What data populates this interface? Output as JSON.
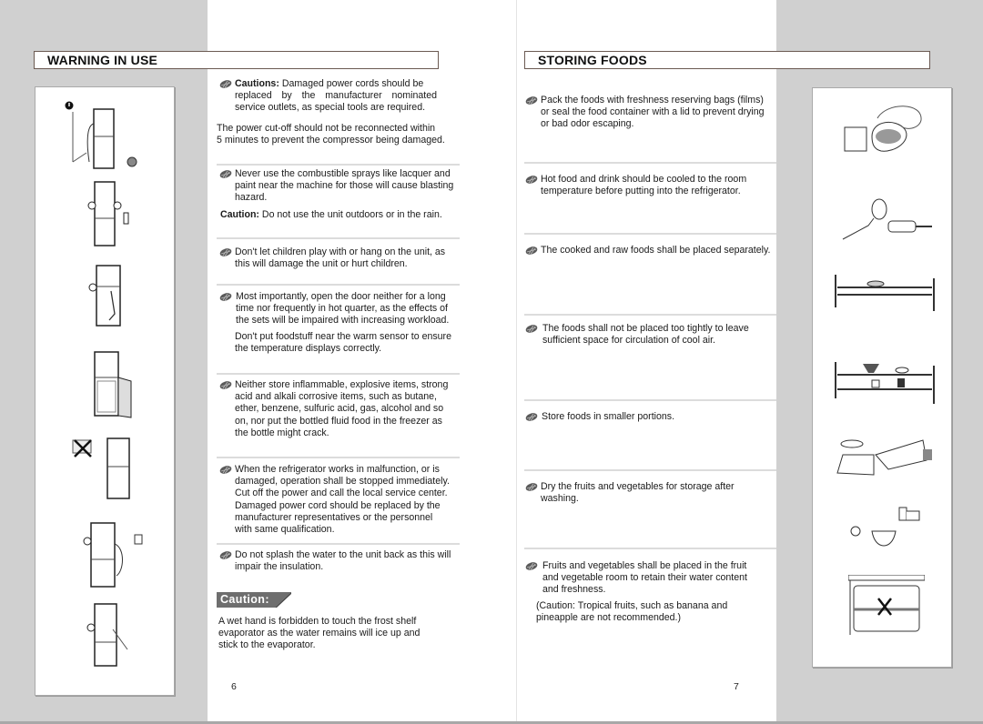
{
  "left_page": {
    "title": "WARNING IN USE",
    "page_number": "6",
    "items": [
      {
        "label": "Cautions:",
        "text_lines": [
          "Damaged power cords should be",
          "replaced  by  the  manufacturer  nominated",
          "service outlets, as special tools are required."
        ],
        "note_lines": [
          "The power cut-off should not be reconnected within",
          "5 minutes to prevent the compressor being damaged."
        ]
      },
      {
        "text_lines": [
          "Never use the combustible sprays like lacquer and",
          "paint near the machine for those will cause blasting",
          "hazard."
        ],
        "note_label": "Caution:",
        "note_text": "Do not use the unit outdoors or in the rain."
      },
      {
        "text_lines": [
          "Don't let children play with or hang on the unit, as",
          "this will damage the unit or hurt children."
        ]
      },
      {
        "text_lines": [
          "Most importantly, open the door neither for a long",
          "time nor frequently in hot quarter, as the effects of",
          "the sets will be impaired with increasing workload."
        ],
        "note_lines": [
          "Don't put foodstuff near the warm sensor to ensure",
          "the temperature displays    correctly."
        ]
      },
      {
        "text_lines": [
          "Neither store inflammable, explosive items, strong",
          "acid and alkali corrosive items, such as butane,",
          "ether, benzene, sulfuric acid, gas, alcohol and so",
          "on, nor put the bottled fluid food in the freezer as",
          "the bottle might crack."
        ]
      },
      {
        "text_lines": [
          "When the refrigerator works in malfunction, or is",
          "damaged, operation shall be stopped immediately.",
          "Cut off the power and call the local service center.",
          "Damaged power cord should be replaced by the",
          "manufacturer representatives or the personnel",
          "with same qualification."
        ]
      },
      {
        "text_lines": [
          "Do not splash the water to the unit back as this will",
          "impair the insulation."
        ]
      }
    ],
    "caution_tag": "Caution:",
    "caution_lines": [
      "A wet hand is forbidden to touch the frost shelf",
      "evaporator as the water remains will ice up and",
      "stick to the evaporator."
    ],
    "illustrations": [
      "refrigerator-unplugged-icon",
      "refrigerator-spray-warning-icon",
      "refrigerator-child-hanging-icon",
      "refrigerator-door-open-icon",
      "refrigerator-no-flammables-icon",
      "refrigerator-power-cord-icon",
      "refrigerator-water-splash-icon"
    ]
  },
  "right_page": {
    "title": "STORING FOODS",
    "page_number": "7",
    "items": [
      {
        "text_lines": [
          "Pack the foods with freshness reserving bags (films)",
          "or seal the food container with a lid to prevent drying",
          "or bad odor escaping."
        ]
      },
      {
        "text_lines": [
          "Hot food and drink should be cooled to the room",
          "temperature before putting into the refrigerator."
        ]
      },
      {
        "text_lines": [
          "The cooked and raw foods shall be placed separately."
        ]
      },
      {
        "text_lines": [
          "The foods shall not be placed too tightly to leave",
          "sufficient space for circulation of cool air."
        ]
      },
      {
        "text_lines": [
          "Store foods in smaller portions."
        ]
      },
      {
        "text_lines": [
          "Dry the fruits and vegetables for storage after",
          "washing."
        ]
      },
      {
        "text_lines": [
          "Fruits and vegetables shall be placed in the fruit",
          "and vegetable room to retain their water content",
          "and freshness."
        ],
        "note_lines": [
          "(Caution: Tropical fruits, such as banana and",
          "pineapple are not recommended.)"
        ]
      }
    ],
    "illustrations": [
      "food-bags-containers-icon",
      "hot-pan-hand-icon",
      "fridge-shelf-fish-icon",
      "fridge-shelves-spaced-icon",
      "fish-cutting-board-wrap-icon",
      "faucet-washing-fruit-icon",
      "crisper-drawer-no-banana-icon"
    ]
  },
  "colors": {
    "page_gray": "#d0d0d0",
    "title_border": "#6b5a52",
    "caution_tag_bg": "#6e6e6e",
    "bullet": "#555555",
    "divider": "#dcdcdc"
  }
}
